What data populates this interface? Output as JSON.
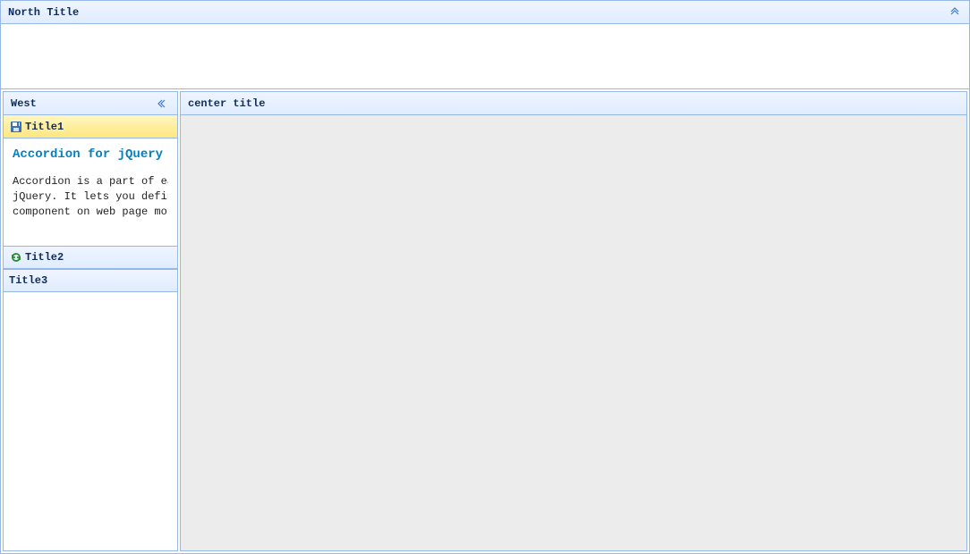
{
  "north": {
    "title": "North Title"
  },
  "west": {
    "title": "West",
    "accordion": [
      {
        "title": "Title1",
        "icon": "save-icon",
        "selected": true,
        "content_heading": "Accordion for jQuery",
        "content_line1": "Accordion is a part of easyui framework for",
        "content_line2": "jQuery. It lets you define your accordion",
        "content_line3": "component on web page more easily."
      },
      {
        "title": "Title2",
        "icon": "reload-icon",
        "selected": false
      },
      {
        "title": "Title3",
        "icon": null,
        "selected": false
      }
    ]
  },
  "center": {
    "title": "center title"
  }
}
